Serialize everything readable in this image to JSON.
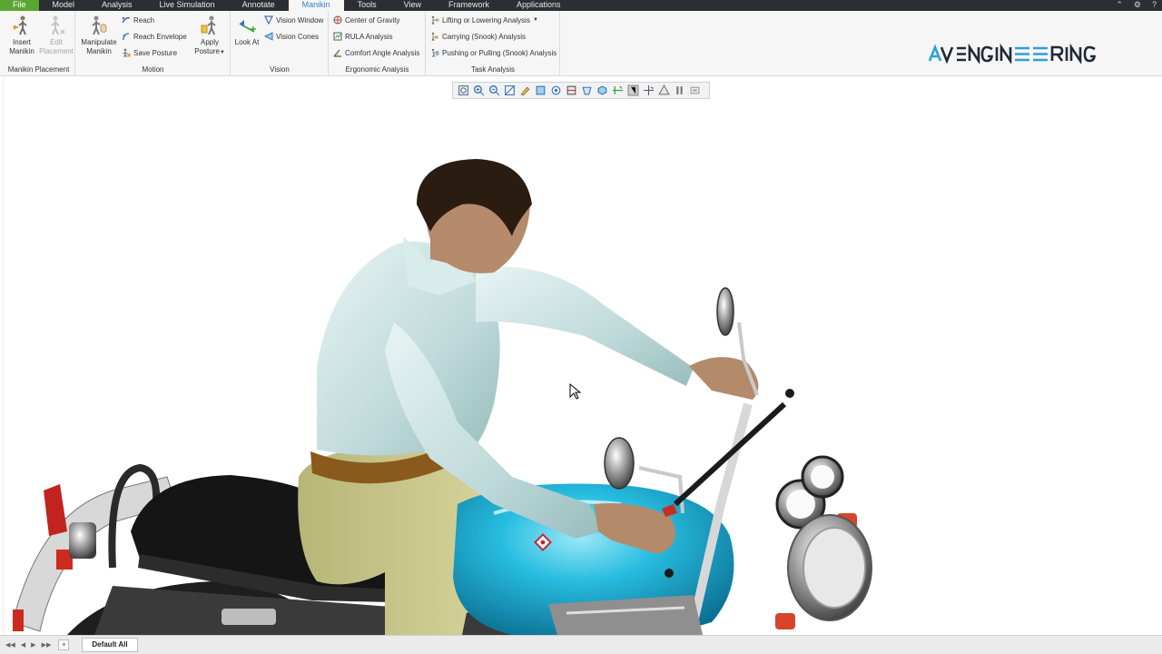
{
  "menu": {
    "tabs": [
      "File",
      "Model",
      "Analysis",
      "Live Simulation",
      "Annotate",
      "Manikin",
      "Tools",
      "View",
      "Framework",
      "Applications"
    ],
    "active": "Manikin"
  },
  "ribbon": {
    "placement": {
      "label": "Manikin Placement",
      "insert_label": "Insert Manikin",
      "insert_line1": "Insert",
      "insert_line2": "Manikin",
      "edit_line1": "Edit",
      "edit_line2": "Placement"
    },
    "motion": {
      "label": "Motion",
      "manipulate_line1": "Manipulate",
      "manipulate_line2": "Manikin",
      "reach": "Reach",
      "reach_envelope": "Reach Envelope",
      "save_posture": "Save Posture",
      "apply_line1": "Apply",
      "apply_line2": "Posture"
    },
    "vision": {
      "label": "Vision",
      "look_at": "Look At",
      "vision_window": "Vision Window",
      "vision_cones": "Vision Cones"
    },
    "ergonomic": {
      "label": "Ergonomic Analysis",
      "center_of_gravity": "Center of Gravity",
      "rula": "RULA Analysis",
      "comfort_angle": "Comfort Angle Analysis"
    },
    "task": {
      "label": "Task Analysis",
      "lifting": "Lifting or Lowering Analysis",
      "carrying": "Carrying (Snook) Analysis",
      "pushing": "Pushing or Pulling (Snook) Analysis"
    }
  },
  "brand": {
    "text": "AVENGINEERING"
  },
  "view_toolbar": {
    "icons": [
      "refit-icon",
      "zoom-in-icon",
      "zoom-out-icon",
      "repaint-icon",
      "style-icon",
      "saved-views-icon",
      "view-manager-icon",
      "section-icon",
      "perspective-icon",
      "display-style-icon",
      "datum-display-icon",
      "annotation-display-icon",
      "spin-center-icon",
      "appearance-icon",
      "pause-icon",
      "close-view-icon"
    ]
  },
  "bottom": {
    "sheet_tab": "Default All",
    "add_tab": "+"
  },
  "colors": {
    "menubar_bg": "#2b2f33",
    "file_tab": "#5aa632",
    "active_tab_text": "#3a7fc2",
    "brand_blue": "#2f9fd8",
    "brand_dark": "#1e2a38",
    "tank_cyan": "#1fb3d6"
  }
}
